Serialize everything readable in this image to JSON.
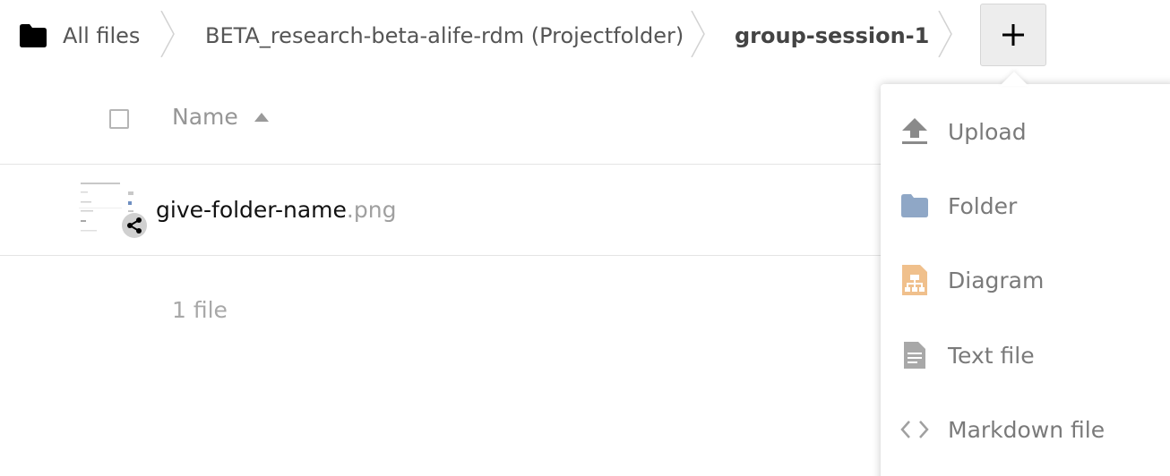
{
  "breadcrumb": {
    "items": [
      {
        "label": "All files"
      },
      {
        "label": "BETA_research-beta-alife-rdm (Projectfolder)"
      },
      {
        "label": "group-session-1"
      }
    ],
    "add_label": "+"
  },
  "file_list": {
    "header": {
      "name_label": "Name"
    },
    "files": [
      {
        "basename": "give-folder-name",
        "extension": ".png"
      }
    ],
    "summary": "1 file"
  },
  "new_menu": {
    "items": [
      {
        "label": "Upload",
        "icon": "upload-icon"
      },
      {
        "label": "Folder",
        "icon": "folder-icon"
      },
      {
        "label": "Diagram",
        "icon": "diagram-icon"
      },
      {
        "label": "Text file",
        "icon": "text-file-icon"
      },
      {
        "label": "Markdown file",
        "icon": "markdown-icon"
      }
    ]
  },
  "colors": {
    "folder": "#8fa7c6",
    "diagram": "#f0c08c",
    "icon_gray": "#9a9a9a"
  }
}
